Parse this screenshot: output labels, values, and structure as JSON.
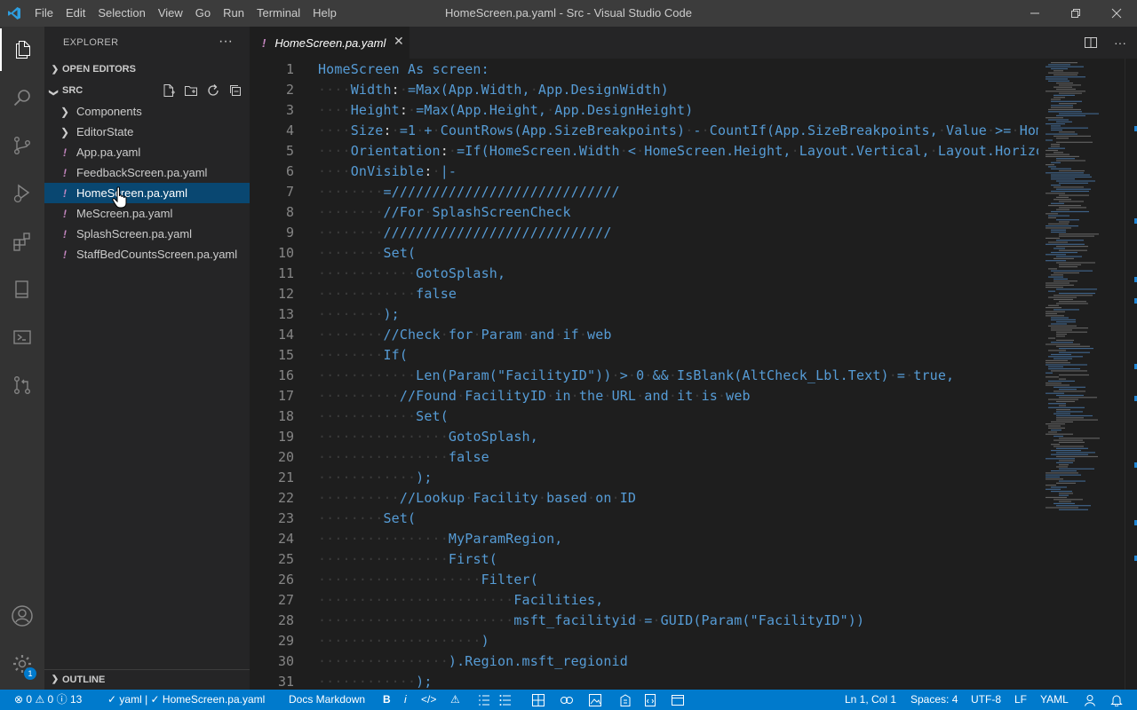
{
  "titlebar": {
    "menu": [
      "File",
      "Edit",
      "Selection",
      "View",
      "Go",
      "Run",
      "Terminal",
      "Help"
    ],
    "title": "HomeScreen.pa.yaml - Src - Visual Studio Code"
  },
  "sidebar": {
    "title": "EXPLORER",
    "more": "···",
    "open_editors": "OPEN EDITORS",
    "src": "SRC",
    "outline": "OUTLINE",
    "items": [
      {
        "label": "Components",
        "type": "folder"
      },
      {
        "label": "EditorState",
        "type": "folder"
      },
      {
        "label": "App.pa.yaml",
        "type": "file"
      },
      {
        "label": "FeedbackScreen.pa.yaml",
        "type": "file"
      },
      {
        "label": "HomeScreen.pa.yaml",
        "type": "file"
      },
      {
        "label": "MeScreen.pa.yaml",
        "type": "file"
      },
      {
        "label": "SplashScreen.pa.yaml",
        "type": "file"
      },
      {
        "label": "StaffBedCountsScreen.pa.yaml",
        "type": "file"
      }
    ],
    "selected_item": "HomeScreen.pa.yaml"
  },
  "tab": {
    "label": "HomeScreen.pa.yaml",
    "file_icon": "!",
    "close": "✕"
  },
  "editor": {
    "lines": [
      "HomeScreen As screen:",
      "    Width: =Max(App.Width, App.DesignWidth)",
      "    Height: =Max(App.Height, App.DesignHeight)",
      "    Size: =1 + CountRows(App.SizeBreakpoints) - CountIf(App.SizeBreakpoints, Value >= Hom",
      "    Orientation: =If(HomeScreen.Width < HomeScreen.Height, Layout.Vertical, Layout.Horizo",
      "    OnVisible: |-",
      "        =////////////////////////////",
      "        //For SplashScreenCheck",
      "        ////////////////////////////",
      "        Set(",
      "            GotoSplash,",
      "            false",
      "        );",
      "        //Check for Param and if web",
      "        If(",
      "            Len(Param(\"FacilityID\")) > 0 && IsBlank(AltCheck_Lbl.Text) = true,",
      "          //Found FacilityID in the URL and it is web",
      "            Set(",
      "                GotoSplash,",
      "                false",
      "            );",
      "          //Lookup Facility based on ID",
      "        Set(",
      "                MyParamRegion,",
      "                First(",
      "                    Filter(",
      "                        Facilities,",
      "                        msft_facilityid = GUID(Param(\"FacilityID\"))",
      "                    )",
      "                ).Region.msft_regionid",
      "            );"
    ]
  },
  "statusbar": {
    "errors": "0",
    "warnings": "0",
    "info": "13",
    "schema": "yaml | ✓ HomeScreen.pa.yaml",
    "docs": "Docs Markdown",
    "bold": "B",
    "italic": "i",
    "code": "</>",
    "cursor": "Ln 1, Col 1",
    "spaces": "Spaces: 4",
    "encoding": "UTF-8",
    "eol": "LF",
    "language": "YAML"
  },
  "activity": {
    "settings_badge": "1"
  },
  "colors": {
    "accent": "#007acc",
    "selection": "#094771",
    "keyword": "#569cd6",
    "yaml_icon": "#c586c0"
  }
}
